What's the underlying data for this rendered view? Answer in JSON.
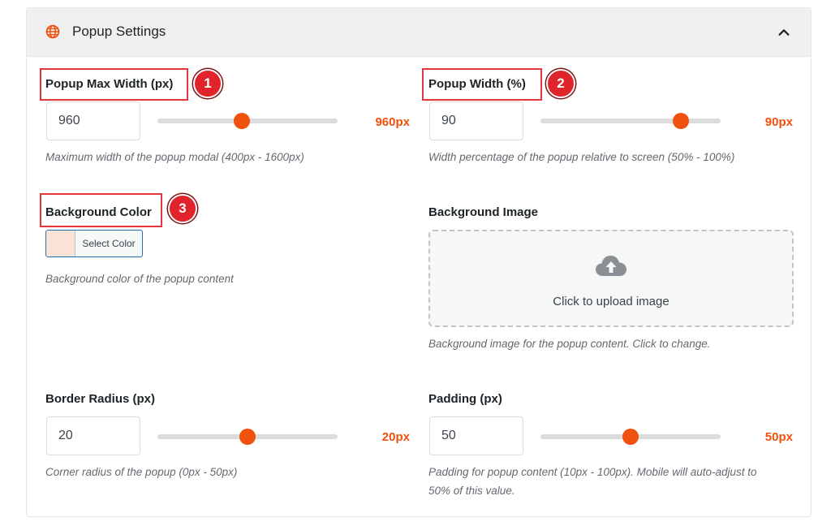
{
  "header": {
    "title": "Popup Settings",
    "icon": "globe-icon",
    "collapse_icon": "chevron-up-icon",
    "accent_color": "#f0510d"
  },
  "fields": {
    "max_width": {
      "label": "Popup Max Width (px)",
      "value": "960",
      "display": "960px",
      "help": "Maximum width of the popup modal (400px - 1600px)",
      "badge": "1",
      "slider_level": 0.47
    },
    "width_pct": {
      "label": "Popup Width (%)",
      "value": "90",
      "display": "90px",
      "help": "Width percentage of the popup relative to screen (50% - 100%)",
      "badge": "2",
      "slider_level": 0.78
    },
    "bg_color": {
      "label": "Background Color",
      "button_label": "Select Color",
      "swatch": "#f9e2d6",
      "help": "Background color of the popup content",
      "badge": "3"
    },
    "bg_image": {
      "label": "Background Image",
      "upload_label": "Click to upload image",
      "icon": "cloud-upload-icon",
      "help": "Background image for the popup content. Click to change."
    },
    "border_radius": {
      "label": "Border Radius (px)",
      "value": "20",
      "display": "20px",
      "help": "Corner radius of the popup (0px - 50px)",
      "slider_level": 0.5
    },
    "padding": {
      "label": "Padding (px)",
      "value": "50",
      "display": "50px",
      "help_line1": "Padding for popup content (10px - 100px). Mobile will auto-adjust to",
      "help_line2": "50% of this value.",
      "slider_level": 0.5
    }
  }
}
